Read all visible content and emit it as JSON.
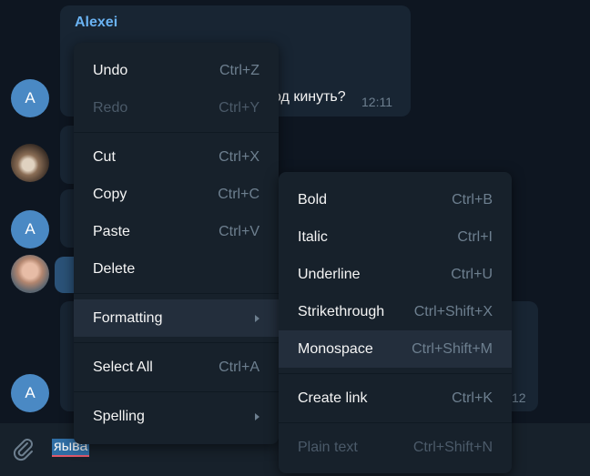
{
  "chat": {
    "message1": {
      "author": "Alexei",
      "text": "од кинуть?",
      "time": "12:11"
    },
    "message_bottom_time": "12",
    "avatar_letter": "A"
  },
  "input": {
    "text": "ыва",
    "highlight_prefix": "я"
  },
  "context_menu": {
    "undo": {
      "label": "Undo",
      "shortcut": "Ctrl+Z"
    },
    "redo": {
      "label": "Redo",
      "shortcut": "Ctrl+Y"
    },
    "cut": {
      "label": "Cut",
      "shortcut": "Ctrl+X"
    },
    "copy": {
      "label": "Copy",
      "shortcut": "Ctrl+C"
    },
    "paste": {
      "label": "Paste",
      "shortcut": "Ctrl+V"
    },
    "delete": {
      "label": "Delete",
      "shortcut": ""
    },
    "formatting": {
      "label": "Formatting"
    },
    "select_all": {
      "label": "Select All",
      "shortcut": "Ctrl+A"
    },
    "spelling": {
      "label": "Spelling"
    }
  },
  "formatting_menu": {
    "bold": {
      "label": "Bold",
      "shortcut": "Ctrl+B"
    },
    "italic": {
      "label": "Italic",
      "shortcut": "Ctrl+I"
    },
    "underline": {
      "label": "Underline",
      "shortcut": "Ctrl+U"
    },
    "strikethrough": {
      "label": "Strikethrough",
      "shortcut": "Ctrl+Shift+X"
    },
    "monospace": {
      "label": "Monospace",
      "shortcut": "Ctrl+Shift+M"
    },
    "create_link": {
      "label": "Create link",
      "shortcut": "Ctrl+K"
    },
    "plain_text": {
      "label": "Plain text",
      "shortcut": "Ctrl+Shift+N"
    }
  },
  "colors": {
    "background": "#0e1621",
    "bubble": "#182533",
    "menu": "#17212b",
    "accent": "#6ab3f3",
    "avatar": "#4a89c4"
  }
}
